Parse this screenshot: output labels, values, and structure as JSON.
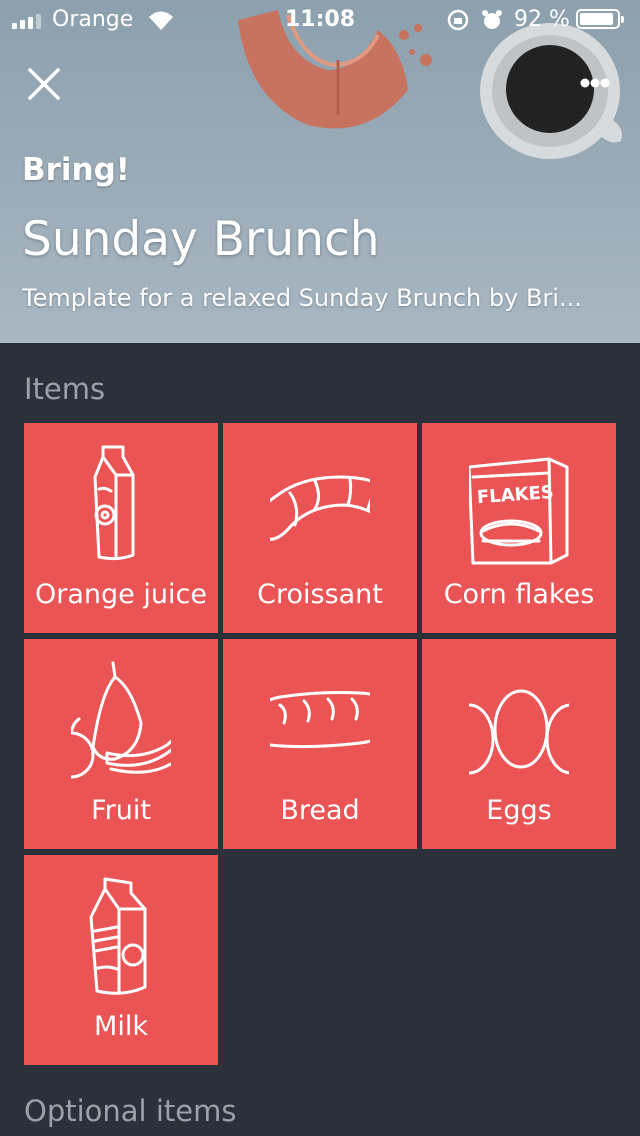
{
  "status_bar": {
    "carrier": "Orange",
    "time": "11:08",
    "battery_pct": "92 %",
    "battery_level": 0.92
  },
  "header": {
    "brand": "Bring!",
    "title": "Sunday Brunch",
    "subtitle": "Template for a relaxed Sunday Brunch by Bri..."
  },
  "sections": {
    "items_label": "Items",
    "optional_label": "Optional items"
  },
  "items": [
    {
      "label": "Orange juice",
      "icon": "orange-juice-icon"
    },
    {
      "label": "Croissant",
      "icon": "croissant-icon"
    },
    {
      "label": "Corn flakes",
      "icon": "corn-flakes-icon"
    },
    {
      "label": "Fruit",
      "icon": "fruit-icon"
    },
    {
      "label": "Bread",
      "icon": "bread-icon"
    },
    {
      "label": "Eggs",
      "icon": "eggs-icon"
    },
    {
      "label": "Milk",
      "icon": "milk-icon"
    }
  ],
  "corn_flakes_box_text": "FLAKES",
  "colors": {
    "tile": "#eb5455",
    "background": "#2c3038",
    "header": "#9aabb7"
  }
}
